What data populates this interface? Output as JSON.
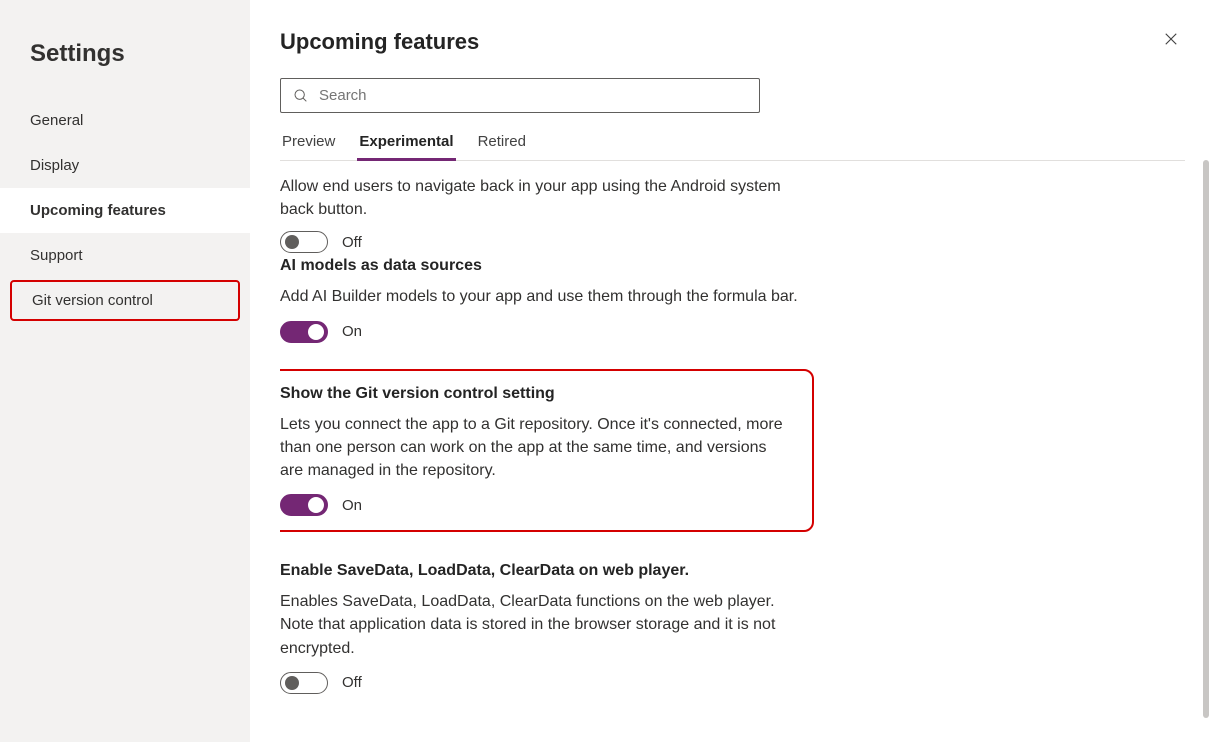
{
  "sidebar": {
    "title": "Settings",
    "items": [
      {
        "label": "General",
        "active": false
      },
      {
        "label": "Display",
        "active": false
      },
      {
        "label": "Upcoming features",
        "active": true
      },
      {
        "label": "Support",
        "active": false
      },
      {
        "label": "Git version control",
        "active": false,
        "highlighted": true
      }
    ]
  },
  "main": {
    "title": "Upcoming features",
    "search_placeholder": "Search",
    "tabs": [
      {
        "label": "Preview",
        "active": false
      },
      {
        "label": "Experimental",
        "active": true
      },
      {
        "label": "Retired",
        "active": false
      }
    ],
    "partial_desc": "Allow end users to navigate back in your app using the Android system back button.",
    "off_label": "Off",
    "on_label": "On",
    "features": [
      {
        "title": "AI models as data sources",
        "desc": "Add AI Builder models to your app and use them through the formula bar.",
        "state": "on"
      },
      {
        "title": "Show the Git version control setting",
        "desc": "Lets you connect the app to a Git repository. Once it's connected, more than one person can work on the app at the same time, and versions are managed in the repository.",
        "state": "on",
        "highlighted": true
      },
      {
        "title": "Enable SaveData, LoadData, ClearData on web player.",
        "desc": "Enables SaveData, LoadData, ClearData functions on the web player. Note that application data is stored in the browser storage and it is not encrypted.",
        "state": "off"
      }
    ]
  }
}
